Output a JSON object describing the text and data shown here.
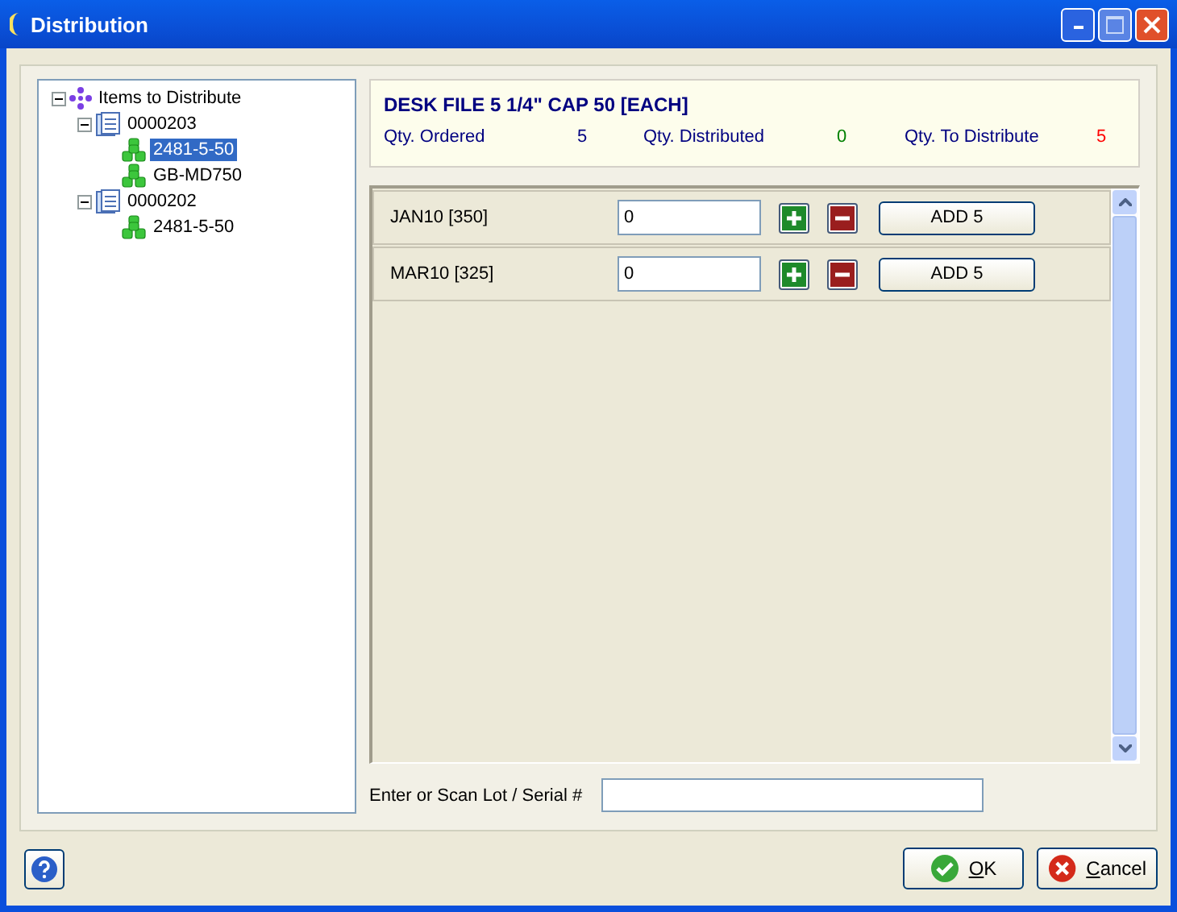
{
  "window": {
    "title": "Distribution"
  },
  "tree": {
    "label": "Items to Distribute",
    "expanded": true,
    "children": [
      {
        "label": "0000203",
        "expanded": true,
        "children": [
          {
            "label": "2481-5-50",
            "selected": true
          },
          {
            "label": "GB-MD750",
            "selected": false
          }
        ]
      },
      {
        "label": "0000202",
        "expanded": true,
        "children": [
          {
            "label": "2481-5-50",
            "selected": false
          }
        ]
      }
    ]
  },
  "item": {
    "title": "DESK FILE 5 1/4\" CAP 50 [EACH]",
    "quantities": [
      {
        "label": "Qty. Ordered",
        "value": "5",
        "color": "#000080"
      },
      {
        "label": "Qty. Distributed",
        "value": "0",
        "color": "#008000"
      },
      {
        "label": "Qty. To Distribute",
        "value": "5",
        "color": "#ff0000"
      }
    ]
  },
  "lots": [
    {
      "name": "JAN10 [350]",
      "value": "0",
      "add_button": "ADD 5"
    },
    {
      "name": "MAR10 [325]",
      "value": "0",
      "add_button": "ADD 5"
    }
  ],
  "lot_entry": {
    "label": "Enter or Scan Lot / Serial #"
  },
  "buttons": [
    {
      "label": "OK",
      "kind": "ok"
    },
    {
      "label": "Cancel",
      "kind": "cancel"
    }
  ]
}
